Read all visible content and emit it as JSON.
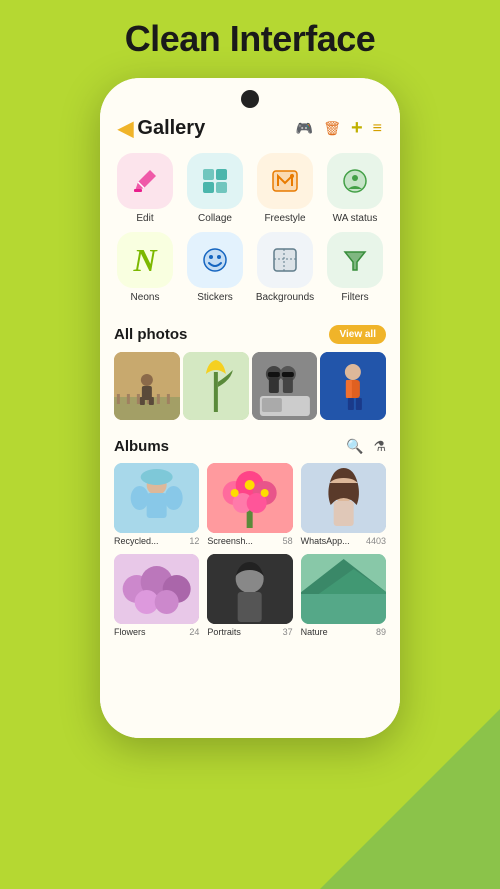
{
  "page": {
    "title": "Clean Interface",
    "background": "#b5d832"
  },
  "header": {
    "back_label": "◀",
    "title": "Gallery",
    "icons": {
      "gamepad": "🎮",
      "trash": "🗑",
      "plus": "+",
      "menu": "≡"
    }
  },
  "tools": [
    {
      "id": "edit",
      "label": "Edit",
      "icon": "edit",
      "emoji": "✏️"
    },
    {
      "id": "collage",
      "label": "Collage",
      "icon": "collage",
      "emoji": "⊞"
    },
    {
      "id": "freestyle",
      "label": "Freestyle",
      "icon": "freestyle",
      "emoji": "🖼"
    },
    {
      "id": "wa-status",
      "label": "WA status",
      "icon": "wa",
      "emoji": "📷"
    },
    {
      "id": "neons",
      "label": "Neons",
      "icon": "neons",
      "emoji": "N"
    },
    {
      "id": "stickers",
      "label": "Stickers",
      "icon": "stickers",
      "emoji": "😊"
    },
    {
      "id": "backgrounds",
      "label": "Backgrounds",
      "icon": "backgrounds",
      "emoji": "▦"
    },
    {
      "id": "filters",
      "label": "Filters",
      "icon": "filters",
      "emoji": "⚗"
    }
  ],
  "all_photos": {
    "section_title": "All photos",
    "view_all_label": "View all"
  },
  "albums": {
    "section_title": "Albums",
    "items": [
      {
        "name": "Recycled...",
        "count": "12"
      },
      {
        "name": "Screensh...",
        "count": "58"
      },
      {
        "name": "WhatsApp...",
        "count": "4403"
      }
    ],
    "items2": [
      {
        "name": "Flowers",
        "count": "24"
      },
      {
        "name": "Portraits",
        "count": "37"
      },
      {
        "name": "Nature",
        "count": "89"
      }
    ]
  }
}
